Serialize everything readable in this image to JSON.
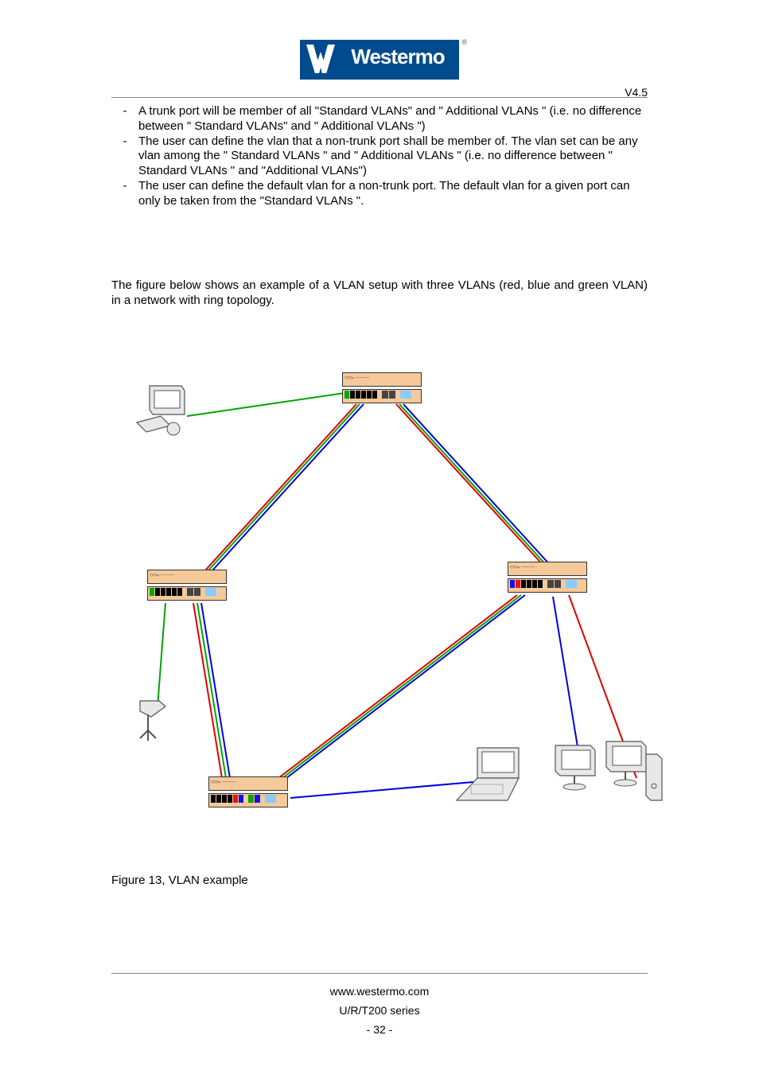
{
  "header": {
    "logo_text": "Westermo",
    "registered": "®",
    "version": "V4.5"
  },
  "bullets": [
    "A trunk port will be member of all \"Standard VLANs\" and \" Additional VLANs \" (i.e. no difference between \" Standard VLANs\" and \" Additional VLANs \")",
    "The user can define the vlan that a non-trunk port shall be member of.  The vlan set can be any vlan among the \" Standard VLANs \" and \" Additional VLANs \" (i.e. no difference between \" Standard VLANs \" and \"Additional VLANs\")",
    "The user can define the default vlan for a non-trunk port.  The default vlan for a given port can only be taken from the \"Standard VLANs \"."
  ],
  "paragraph": "The figure below shows an example of a VLAN setup with three VLANs (red, blue and green VLAN) in a network with ring topology.",
  "figure_caption": "Figure 13, VLAN example",
  "footer": {
    "url": "www.westermo.com",
    "series": "U/R/T200 series",
    "page": "- 32 -"
  }
}
